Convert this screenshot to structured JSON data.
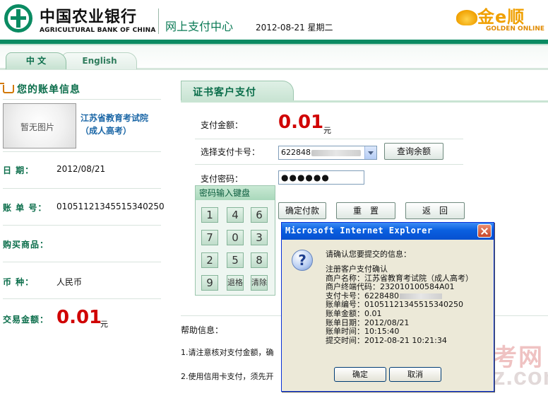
{
  "header": {
    "bank_name_cn": "中国农业银行",
    "bank_name_en": "AGRICULTURAL BANK OF CHINA",
    "center_title": "网上支付中心",
    "date": "2012-08-21 星期二",
    "partner_logo_cn": "金e顺",
    "partner_logo_en": "GOLDEN ONLINE"
  },
  "tabs": {
    "chinese": "中 文",
    "english": "English"
  },
  "bill": {
    "title": "您的账单信息",
    "no_image": "暂无图片",
    "merchant": "江苏省教育考试院（成人高考）",
    "date_label": "日 期：",
    "date_value": "2012/08/21",
    "bill_no_label": "账 单 号：",
    "bill_no_value": "01051121345515340250",
    "goods_label": "购买商品：",
    "goods_value": "",
    "currency_label": "币 种：",
    "currency_value": "人民币",
    "amount_label": "交易金额：",
    "amount_value": "0.01",
    "amount_unit": "元"
  },
  "payment": {
    "tab_title": "证书客户支付",
    "amount_label": "支付金额：",
    "amount_value": "0.01",
    "amount_unit": "元",
    "card_label": "选择支付卡号：",
    "card_value": "622848",
    "query_balance": "查询余额",
    "password_label": "支付密码：",
    "password_value": "●●●●●●",
    "confirm_pay": "确定付款",
    "reset": "重　置",
    "back": "返　回"
  },
  "keypad": {
    "title": "密码输入键盘",
    "keys": [
      "1",
      "4",
      "6",
      "7",
      "0",
      "3",
      "2",
      "5",
      "8",
      "9",
      "退格",
      "清除"
    ]
  },
  "help": {
    "title": "帮助信息：",
    "item1": "1.请注意核对支付金额，确",
    "item2": "2.使用信用卡支付，须先开"
  },
  "dialog": {
    "title": "Microsoft Internet Explorer",
    "message": "请确认您要提交的信息：",
    "lines": [
      "注册客户支付确认",
      "商户名称：江苏省教育考试院（成人高考）",
      "商户终端代码：232010100584A01",
      "支付卡号：6228480",
      "账单编号：01051121345515340250",
      "账单金额：0.01",
      "账单日期：2012/08/21",
      "账单时间：10:15:40",
      "提交时间：2012-08-21 10:21:34"
    ],
    "ok": "确定",
    "cancel": "取消"
  },
  "watermark": {
    "cn": "易考网",
    "en": "Yipxz.com"
  },
  "colors": {
    "brand_green": "#0a8b62",
    "amount_red": "#d00000",
    "xp_blue": "#0a5fe0"
  }
}
